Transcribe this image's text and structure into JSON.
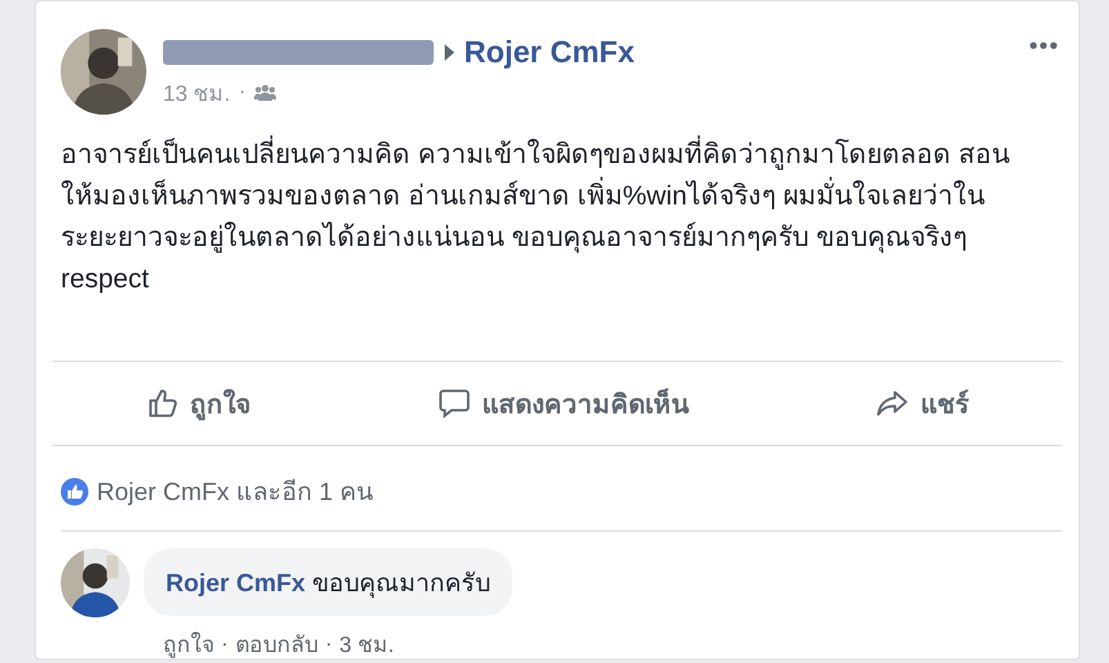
{
  "post": {
    "author_redacted": true,
    "target": "Rojer CmFx",
    "time": "13 ชม.",
    "separator": "·",
    "text": "อาจารย์เป็นคนเปลี่ยนความคิด ความเข้าใจผิดๆของผมที่คิดว่าถูกมาโดยตลอด สอนให้มองเห็นภาพรวมของตลาด อ่านเกมส์ขาด เพิ่ม%winได้จริงๆ ผมมั่นใจเลยว่าในระยะยาวจะอยู่ในตลาดได้อย่างแน่นอน ขอบคุณอาจารย์มากๆครับ ขอบคุณจริงๆ respect",
    "menu": "•••"
  },
  "actions": [
    {
      "kind": "like",
      "label": "ถูกใจ"
    },
    {
      "kind": "comment",
      "label": "แสดงความคิดเห็น"
    },
    {
      "kind": "share",
      "label": "แชร์"
    }
  ],
  "reactions": {
    "text": "Rojer CmFx และอีก 1 คน"
  },
  "comments": [
    {
      "author": "Rojer CmFx",
      "text": "ขอบคุณมากครับ",
      "links": [
        "ถูกใจ",
        "ตอบกลับ"
      ],
      "separators": [
        "·",
        "·"
      ],
      "time": "3 ชม."
    }
  ]
}
